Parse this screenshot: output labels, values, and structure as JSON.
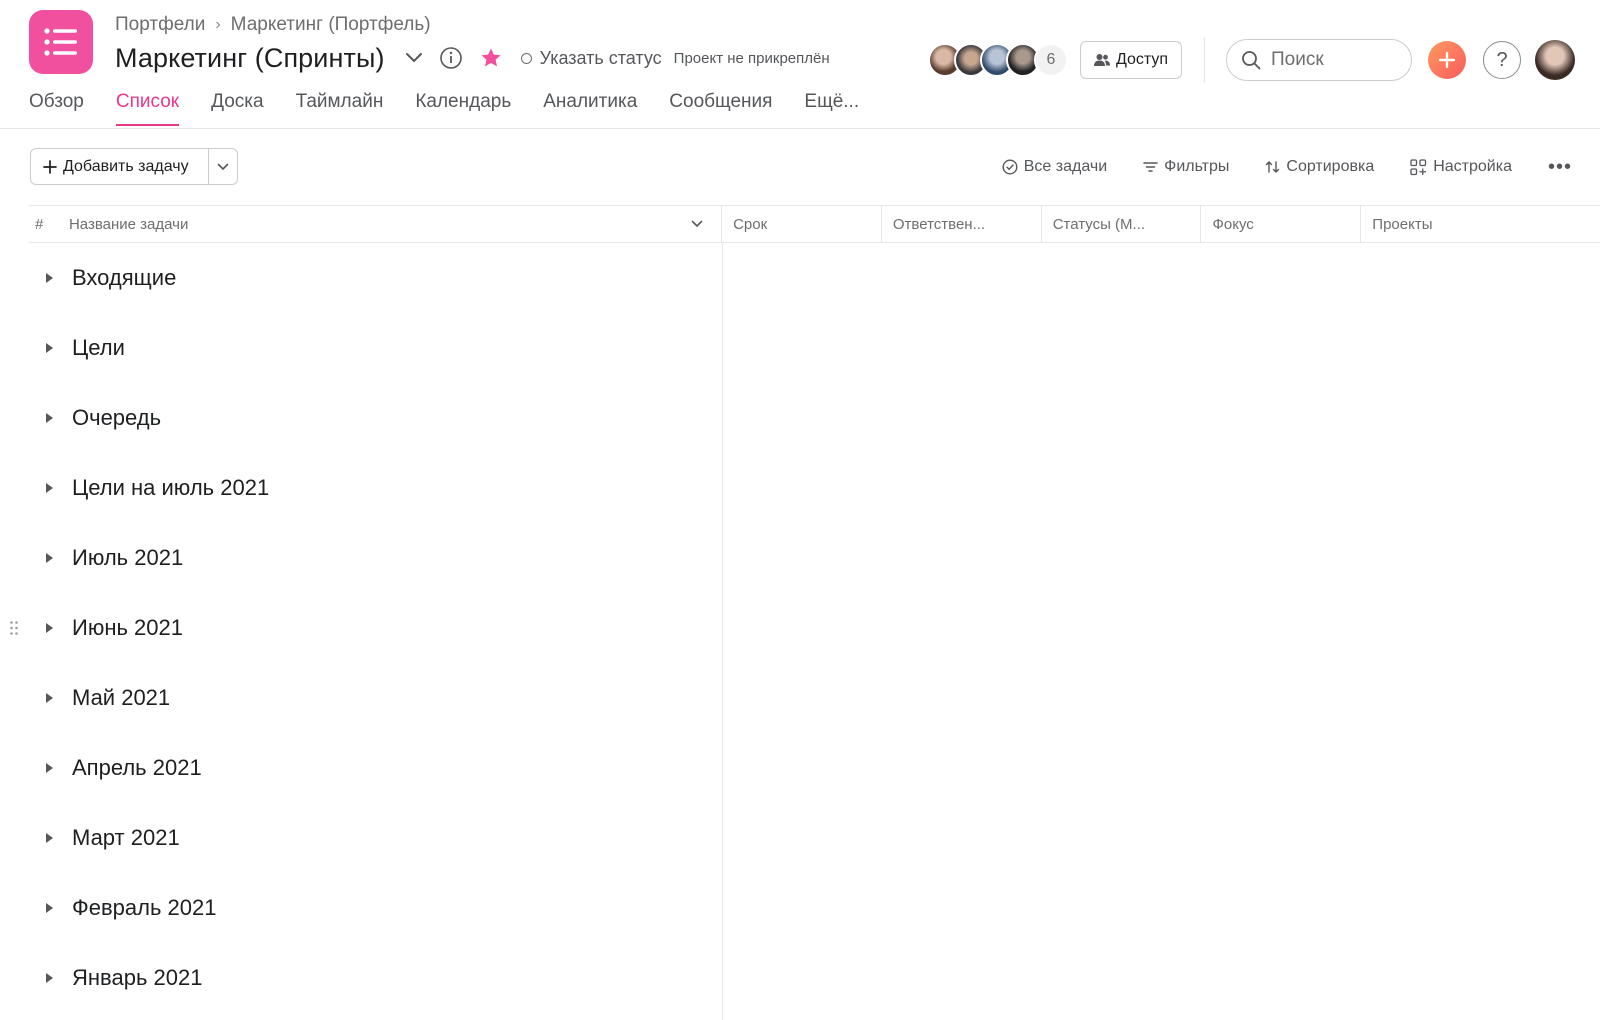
{
  "header": {
    "breadcrumb": [
      "Портфели",
      "Маркетинг (Портфель)"
    ],
    "breadcrumb_sep": "›",
    "title": "Маркетинг (Спринты)",
    "status_label": "Указать статус",
    "pin_note": "Проект не прикреплён",
    "member_count": "6",
    "access_label": "Доступ",
    "search_placeholder": "Поиск",
    "help_label": "?"
  },
  "tabs": [
    {
      "label": "Обзор",
      "active": false
    },
    {
      "label": "Список",
      "active": true
    },
    {
      "label": "Доска",
      "active": false
    },
    {
      "label": "Таймлайн",
      "active": false
    },
    {
      "label": "Календарь",
      "active": false
    },
    {
      "label": "Аналитика",
      "active": false
    },
    {
      "label": "Сообщения",
      "active": false
    },
    {
      "label": "Ещё...",
      "active": false
    }
  ],
  "toolbar": {
    "add_task_label": "Добавить задачу",
    "all_tasks_label": "Все задачи",
    "filters_label": "Фильтры",
    "sort_label": "Сортировка",
    "settings_label": "Настройка",
    "more_label": "•••"
  },
  "table": {
    "hash": "#",
    "name_col": "Название задачи",
    "columns": [
      "Срок",
      "Ответствен...",
      "Статусы (М...",
      "Фокус",
      "Проекты"
    ]
  },
  "sections": [
    "Входящие",
    "Цели",
    "Очередь",
    "Цели на июль 2021",
    "Июль 2021",
    "Июнь 2021",
    "Май 2021",
    "Апрель 2021",
    "Март 2021",
    "Февраль 2021",
    "Январь 2021"
  ],
  "colors": {
    "accent": "#e8388a",
    "app_icon": "#f0509e",
    "star": "#f0509e",
    "plus_gradient_start": "#fd9a60",
    "plus_gradient_end": "#f95b5b"
  }
}
